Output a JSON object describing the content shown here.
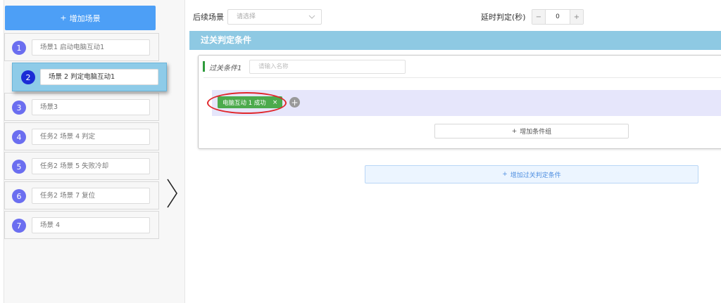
{
  "sidebar": {
    "add_scene_icon": "+",
    "add_scene_label": "增加场景",
    "items": [
      {
        "num": "1",
        "label": "场景1 启动电脑互动1"
      },
      {
        "num": "2",
        "label": "场景 2 判定电脑互动1"
      },
      {
        "num": "3",
        "label": "场景3"
      },
      {
        "num": "4",
        "label": "任务2 场景 4 判定"
      },
      {
        "num": "5",
        "label": "任务2  场景 5 失败冷却"
      },
      {
        "num": "6",
        "label": "任务2 场景 7 复位"
      },
      {
        "num": "7",
        "label": "场景 4"
      }
    ]
  },
  "topbar": {
    "next_scene_label": "后续场景",
    "next_scene_placeholder": "请选择",
    "delay_label": "延时判定(秒)",
    "delay_minus": "−",
    "delay_value": "0",
    "delay_plus": "+"
  },
  "conditions": {
    "header": "过关判定条件",
    "condition_label": "过关条件1",
    "name_placeholder": "请输入名称",
    "tag_label": "电脑互动 1 成功",
    "tag_close": "×",
    "add_condition_icon": "+",
    "add_group_icon": "+",
    "add_group_label": "增加条件组",
    "add_pass_icon": "+",
    "add_pass_label": "增加过关判定条件"
  },
  "colors": {
    "primary": "#4d9ff6",
    "scene_badge": "#6b6ef0",
    "dragged_badge": "#1b2cd6",
    "header_bg": "#8ec9e3",
    "tag_bg": "#4caa4c",
    "highlight_ellipse": "#e0262b"
  }
}
